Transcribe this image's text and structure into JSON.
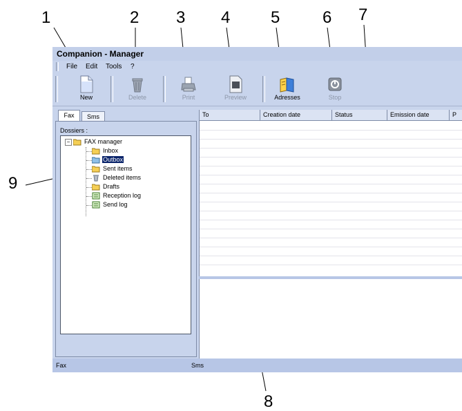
{
  "callouts": {
    "c1": "1",
    "c2": "2",
    "c3": "3",
    "c4": "4",
    "c5": "5",
    "c6": "6",
    "c7": "7",
    "c8": "8",
    "c9": "9"
  },
  "window": {
    "title": "Companion - Manager"
  },
  "menu": {
    "file": "File",
    "edit": "Edit",
    "tools": "Tools",
    "help": "?"
  },
  "toolbar": {
    "new_label": "New",
    "delete_label": "Delete",
    "print_label": "Print",
    "preview_label": "Preview",
    "adresses_label": "Adresses",
    "stop_label": "Stop"
  },
  "tabs": {
    "fax": "Fax",
    "sms": "Sms"
  },
  "tree": {
    "heading": "Dossiers :",
    "root": "FAX manager",
    "items": [
      "Inbox",
      "Outbox",
      "Sent items",
      "Deleted items",
      "Drafts",
      "Reception log",
      "Send log"
    ],
    "selected": "Outbox"
  },
  "grid": {
    "columns": [
      "To",
      "Creation date",
      "Status",
      "Emission date",
      "P"
    ]
  },
  "statusbar": {
    "left": "Fax",
    "right": "Sms"
  },
  "colors": {
    "window_bg": "#c8d4ec",
    "selection": "#0a246a",
    "statusbar": "#b7c6e6"
  }
}
